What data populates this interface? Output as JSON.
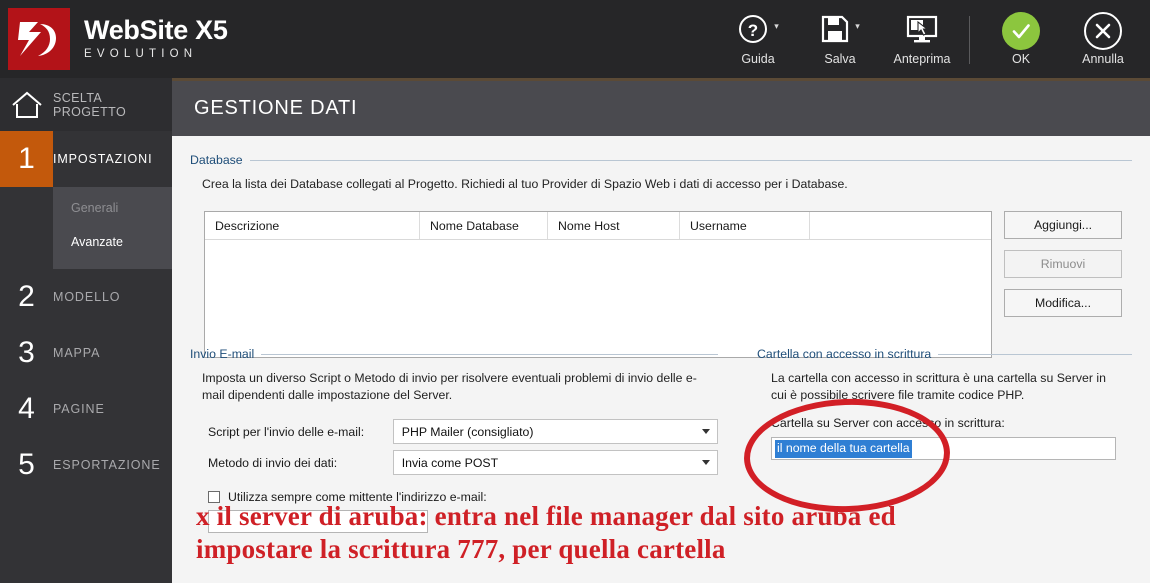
{
  "app": {
    "brand_main": "WebSite X5",
    "brand_sub": "EVOLUTION",
    "logo_icon": "x5-logo-icon"
  },
  "toolbar": {
    "items": [
      {
        "label": "Guida",
        "icon": "help-question-icon",
        "has_caret": true
      },
      {
        "label": "Salva",
        "icon": "floppy-save-icon",
        "has_caret": true
      },
      {
        "label": "Anteprima",
        "icon": "monitor-preview-icon",
        "has_caret": false
      }
    ],
    "ok_label": "OK",
    "ok_icon": "check-circle-icon",
    "cancel_label": "Annulla",
    "cancel_icon": "close-circle-icon",
    "ok_color": "#8cc63e"
  },
  "sidebar": {
    "home": {
      "label_line1": "SCELTA",
      "label_line2": "PROGETTO",
      "icon": "home-icon"
    },
    "items": [
      {
        "num": "1",
        "label": "IMPOSTAZIONI",
        "active": true
      },
      {
        "num": "2",
        "label": "MODELLO",
        "active": false
      },
      {
        "num": "3",
        "label": "MAPPA",
        "active": false
      },
      {
        "num": "4",
        "label": "PAGINE",
        "active": false
      },
      {
        "num": "5",
        "label": "ESPORTAZIONE",
        "active": false
      }
    ],
    "subitems": [
      {
        "label": "Generali",
        "selected": false
      },
      {
        "label": "Avanzate",
        "selected": true
      }
    ],
    "active_color": "#c3590c"
  },
  "page": {
    "title": "GESTIONE DATI"
  },
  "database": {
    "legend": "Database",
    "description": "Crea la lista dei Database collegati al Progetto. Richiedi al tuo Provider di Spazio Web i dati di accesso per i Database.",
    "columns": [
      "Descrizione",
      "Nome Database",
      "Nome Host",
      "Username",
      ""
    ],
    "rows": [],
    "buttons": [
      {
        "label": "Aggiungi...",
        "disabled": false
      },
      {
        "label": "Rimuovi",
        "disabled": true
      },
      {
        "label": "Modifica...",
        "disabled": false
      }
    ]
  },
  "email": {
    "legend": "Invio E-mail",
    "description": "Imposta un diverso Script o Metodo di invio per risolvere eventuali problemi di invio delle e-mail dipendenti dalle impostazione del Server.",
    "script_label": "Script per l'invio delle e-mail:",
    "script_value": "PHP Mailer (consigliato)",
    "method_label": "Metodo di invio dei dati:",
    "method_value": "Invia come POST",
    "checkbox_label": "Utilizza sempre come mittente l'indirizzo e-mail:",
    "checkbox_checked": false,
    "sender_value": ""
  },
  "writable_folder": {
    "legend": "Cartella con accesso in scrittura",
    "description": "La cartella con accesso in scrittura è una cartella su Server in cui è possibile scrivere file tramite codice PHP.",
    "field_label": "Cartella su Server con accesso in scrittura:",
    "field_value": "il nome della tua cartella",
    "selection_color": "#2f7fd4"
  },
  "annotations": {
    "color": "#cf2026",
    "circle_target": "writable-folder-input",
    "note_line1": "x il server di aruba: entra nel file manager dal sito aruba ed",
    "note_line2": "impostare la scrittura 777, per quella cartella"
  }
}
